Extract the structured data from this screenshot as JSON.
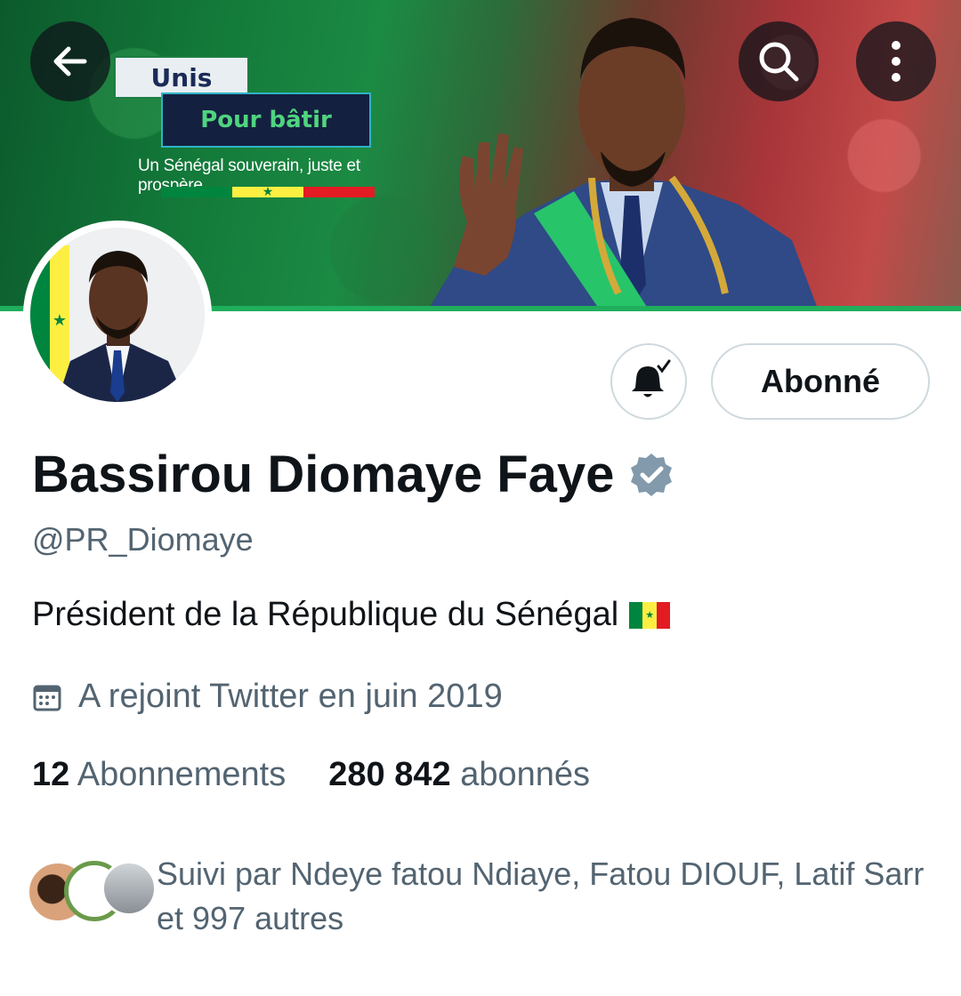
{
  "banner": {
    "slogan_line1": "Unis",
    "slogan_line2": "Pour bâtir",
    "tagline": "Un Sénégal souverain, juste et prospère",
    "flag_colors": [
      "#00853f",
      "#fdef42",
      "#e31b23"
    ]
  },
  "header": {
    "back_icon": "arrow-left-icon",
    "search_icon": "search-icon",
    "more_icon": "more-vertical-icon"
  },
  "profile": {
    "name": "Bassirou Diomaye Faye",
    "handle": "@PR_Diomaye",
    "verified_color": "#829aab",
    "bio": "Président de la République du Sénégal",
    "joined": "A rejoint Twitter en juin 2019",
    "following_count": "12",
    "following_label": "Abonnements",
    "followers_count": "280 842",
    "followers_label": "abonnés",
    "followed_by": "Suivi par Ndeye fatou Ndiaye, Fatou DIOUF, Latif Sarr et 997 autres"
  },
  "actions": {
    "notify_icon": "bell-check-icon",
    "follow_label": "Abonné"
  }
}
